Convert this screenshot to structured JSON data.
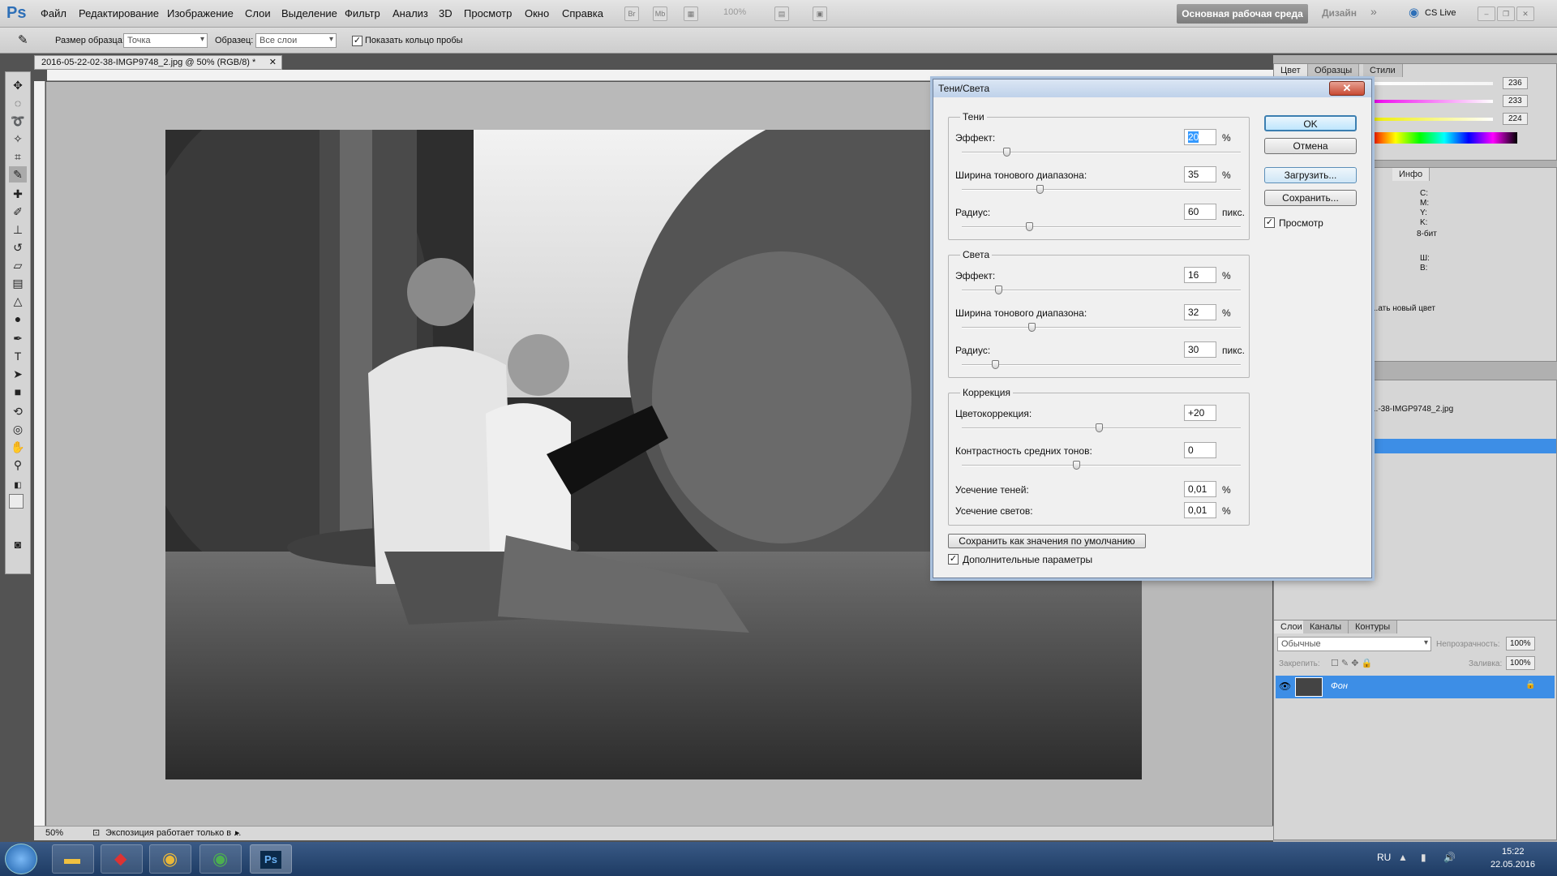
{
  "menubar": {
    "logo": "Ps",
    "items": [
      "Файл",
      "Редактирование",
      "Изображение",
      "Слои",
      "Выделение",
      "Фильтр",
      "Анализ",
      "3D",
      "Просмотр",
      "Окно",
      "Справка"
    ],
    "zoom": "100%",
    "workspace": "Основная рабочая среда",
    "design": "Дизайн",
    "cslive": "CS Live"
  },
  "options": {
    "sample_size_label": "Размер образца:",
    "sample_size_value": "Точка",
    "sample_label": "Образец:",
    "sample_value": "Все слои",
    "show_ring": "Показать кольцо пробы"
  },
  "document": {
    "tab_title": "2016-05-22-02-38-IMGP9748_2.jpg @ 50% (RGB/8) *",
    "zoom": "50%",
    "status": "Экспозиция работает только в ..."
  },
  "dialog": {
    "title": "Тени/Света",
    "shadows": {
      "title": "Тени",
      "amount_label": "Эффект:",
      "amount": "20",
      "amount_unit": "%",
      "tonal_label": "Ширина тонового диапазона:",
      "tonal": "35",
      "tonal_unit": "%",
      "radius_label": "Радиус:",
      "radius": "60",
      "radius_unit": "пикс."
    },
    "highlights": {
      "title": "Света",
      "amount_label": "Эффект:",
      "amount": "16",
      "amount_unit": "%",
      "tonal_label": "Ширина тонового диапазона:",
      "tonal": "32",
      "tonal_unit": "%",
      "radius_label": "Радиус:",
      "radius": "30",
      "radius_unit": "пикс."
    },
    "adjust": {
      "title": "Коррекция",
      "color_label": "Цветокоррекция:",
      "color": "+20",
      "midtone_label": "Контрастность средних тонов:",
      "midtone": "0",
      "black_clip_label": "Усечение теней:",
      "black_clip": "0,01",
      "black_clip_unit": "%",
      "white_clip_label": "Усечение светов:",
      "white_clip": "0,01",
      "white_clip_unit": "%"
    },
    "slider_levels": {
      "sh_amount": 0.16,
      "sh_tonal": 0.28,
      "sh_radius": 0.24,
      "hl_amount": 0.13,
      "hl_tonal": 0.25,
      "hl_radius": 0.12,
      "color": 0.49,
      "midtone": 0.41
    },
    "save_default": "Сохранить как значения по умолчанию",
    "more_options": "Дополнительные параметры",
    "ok": "OK",
    "cancel": "Отмена",
    "load": "Загрузить...",
    "save": "Сохранить...",
    "preview": "Просмотр"
  },
  "panels": {
    "color_tabs": [
      "Цвет",
      "Образцы",
      "Стили"
    ],
    "color_values": [
      "236",
      "233",
      "224"
    ],
    "info_tab": "Инфо",
    "info_cmyk": [
      "C:",
      "M:",
      "Y:",
      "K:"
    ],
    "info_bits": "8-бит",
    "info_wh": [
      "Ш:",
      "В:"
    ],
    "new_color_hint": "...ать новый цвет",
    "history_item": "...-38-IMGP9748_2.jpg",
    "layers_tabs": [
      "Слои",
      "Каналы",
      "Контуры"
    ],
    "blend_mode": "Обычные",
    "opacity_label": "Непрозрачность:",
    "opacity": "100%",
    "lock_label": "Закрепить:",
    "fill_label": "Заливка:",
    "fill": "100%",
    "layer_name": "Фон"
  },
  "taskbar": {
    "lang": "RU",
    "time": "15:22",
    "date": "22.05.2016"
  }
}
